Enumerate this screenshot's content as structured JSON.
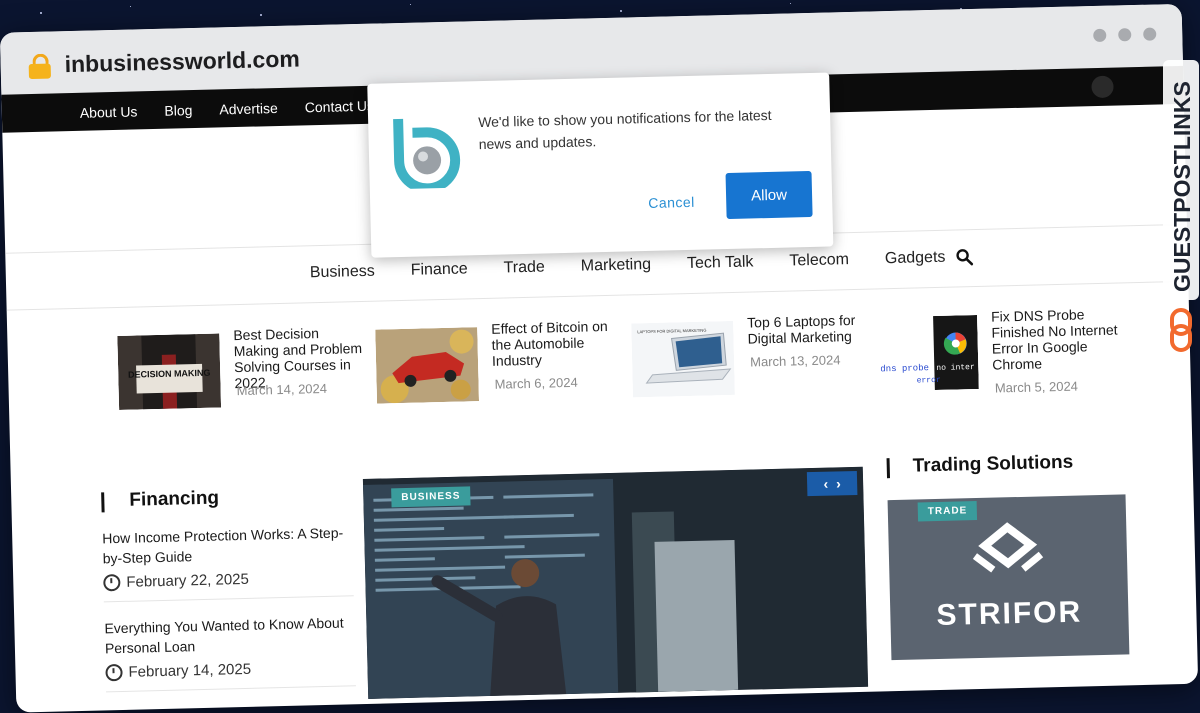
{
  "browser": {
    "url": "inbusinessworld.com"
  },
  "topbar": {
    "links": [
      "About Us",
      "Blog",
      "Advertise",
      "Contact Us"
    ]
  },
  "nav": {
    "items": [
      "Business",
      "Finance",
      "Trade",
      "Marketing",
      "Tech Talk",
      "Telecom",
      "Gadgets"
    ]
  },
  "posts": [
    {
      "title": "Best Decision Making and Problem Solving Courses in 2022",
      "date": "March 14, 2024"
    },
    {
      "title": "Effect of Bitcoin on the Automobile Industry",
      "date": "March 6, 2024"
    },
    {
      "title": "Top 6 Laptops for Digital Marketing",
      "date": "March 13, 2024"
    },
    {
      "title": "Fix DNS Probe Finished No Internet Error In Google Chrome",
      "date": "March 5, 2024"
    }
  ],
  "thumb_text": {
    "decision": "DECISION MAKING",
    "laptop": "LAPTOPS FOR DIGITAL MARKETING",
    "dns": "dns probe",
    "dns2": "no inter",
    "dns3": "error"
  },
  "financing": {
    "heading": "Financing",
    "items": [
      {
        "title": "How Income Protection Works: A Step-by-Step Guide",
        "date": "February 22, 2025"
      },
      {
        "title": "Everything You Wanted to Know About Personal Loan",
        "date": "February 14, 2025"
      }
    ]
  },
  "hero": {
    "badge": "BUSINESS",
    "prev": "‹",
    "next": "›"
  },
  "trading": {
    "heading": "Trading Solutions",
    "badge": "TRADE",
    "brand": "STRIFOR"
  },
  "notification": {
    "message": "We'd like to show you notifications for the latest news and updates.",
    "cancel": "Cancel",
    "allow": "Allow"
  },
  "watermark": {
    "text": "GUESTPOSTLINKS"
  },
  "colors": {
    "accent_blue": "#1775d1",
    "badge_teal": "#3a9c9c",
    "lock": "#f5b31c",
    "watermark_orange": "#f26a2e"
  }
}
